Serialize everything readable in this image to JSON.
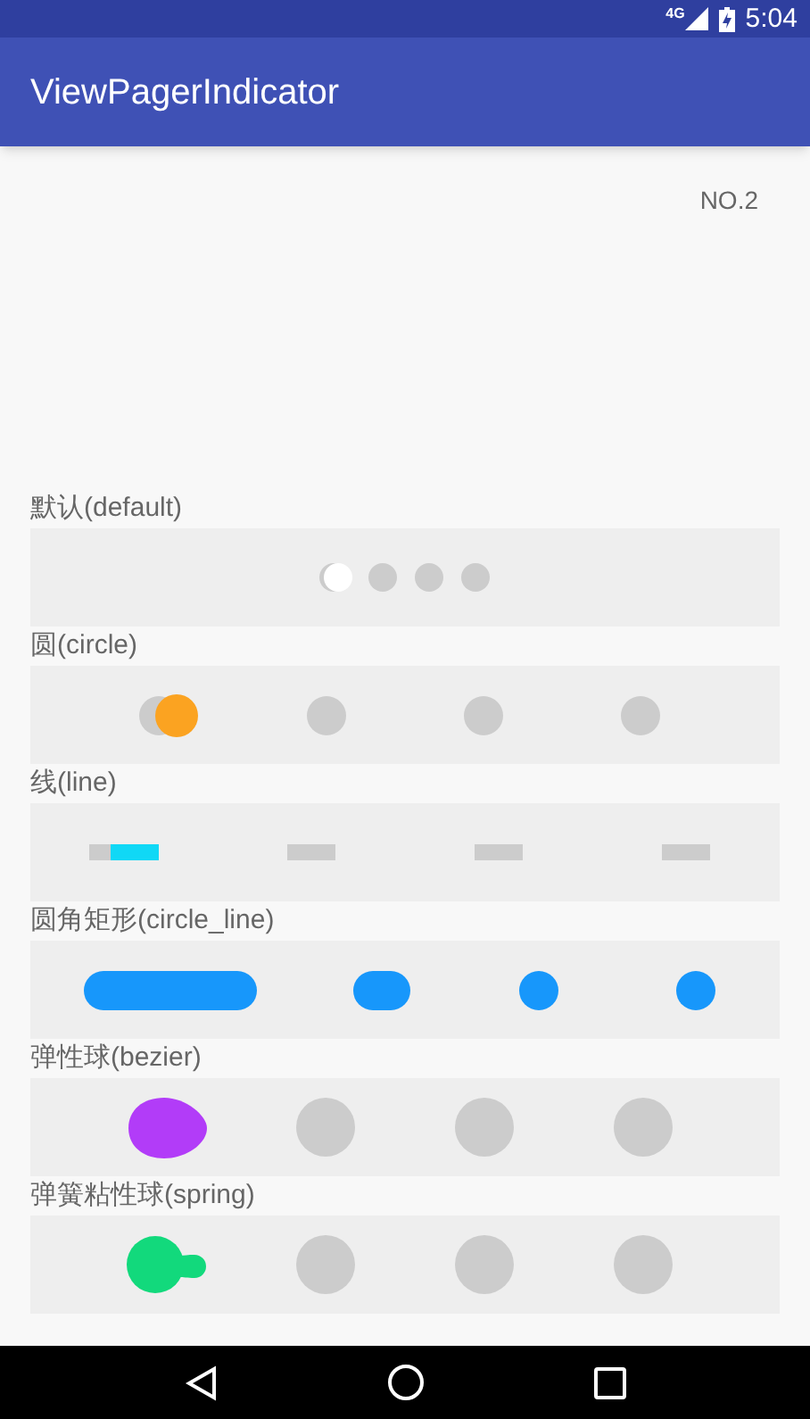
{
  "status_bar": {
    "network": "4G",
    "time": "5:04"
  },
  "app_bar": {
    "title": "ViewPagerIndicator"
  },
  "page": {
    "label": "NO.2"
  },
  "indicators": [
    {
      "label": "默认(default)",
      "kind": "default",
      "color": "#ffffff",
      "dots": [
        {
          "selected": true
        },
        {
          "selected": false
        },
        {
          "selected": false
        },
        {
          "selected": false
        }
      ]
    },
    {
      "label": "圆(circle)",
      "kind": "circle",
      "color": "#fba321",
      "dots": [
        {
          "selected": true
        },
        {
          "selected": false
        },
        {
          "selected": false
        },
        {
          "selected": false
        }
      ]
    },
    {
      "label": "线(line)",
      "kind": "line",
      "color": "#10d8f6",
      "dots": [
        {
          "selected": true
        },
        {
          "selected": false
        },
        {
          "selected": false
        },
        {
          "selected": false
        }
      ]
    },
    {
      "label": "圆角矩形(circle_line)",
      "kind": "circle_line",
      "color": "#1797fb",
      "dots": [
        {
          "kind": "wide"
        },
        {
          "kind": "short"
        },
        {
          "kind": "round"
        },
        {
          "kind": "round"
        }
      ]
    },
    {
      "label": "弹性球(bezier)",
      "kind": "bezier",
      "color": "#b23cf8",
      "dots": [
        {
          "selected": true
        },
        {
          "selected": false
        },
        {
          "selected": false
        },
        {
          "selected": false
        }
      ]
    },
    {
      "label": "弹簧粘性球(spring)",
      "kind": "spring",
      "color": "#12d97c",
      "dots": [
        {
          "selected": true
        },
        {
          "selected": false
        },
        {
          "selected": false
        },
        {
          "selected": false
        }
      ]
    }
  ]
}
